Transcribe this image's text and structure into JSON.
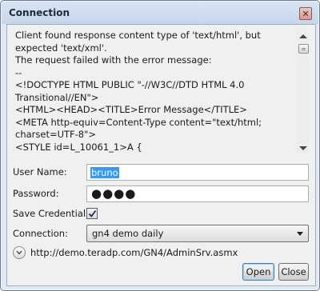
{
  "window": {
    "title": "Connection",
    "close_glyph": "✕"
  },
  "message": {
    "text": "Client found response content type of 'text/html', but expected 'text/xml'.\nThe request failed with the error message:\n--\n<!DOCTYPE HTML PUBLIC \"-//W3C//DTD HTML 4.0 Transitional//EN\">\n<HTML><HEAD><TITLE>Error Message</TITLE>\n<META http-equiv=Content-Type content=\"text/html; charset=UTF-8\">\n<STYLE id=L_10061_1>A {"
  },
  "form": {
    "user_label": "User Name:",
    "user_value": "bruno",
    "password_label": "Password:",
    "password_value": "●●●●",
    "save_label": "Save Credentials:",
    "save_checked": true,
    "connection_label": "Connection:",
    "connection_value": "gn4 demo daily"
  },
  "url": "http://demo.teradp.com/GN4/AdminSrv.asmx",
  "buttons": {
    "open": "Open",
    "close": "Close"
  },
  "icons": {
    "window_close": "close-icon",
    "check": "checkmark-icon",
    "dropdown": "chevron-down-icon",
    "expander": "chevron-down-icon"
  }
}
